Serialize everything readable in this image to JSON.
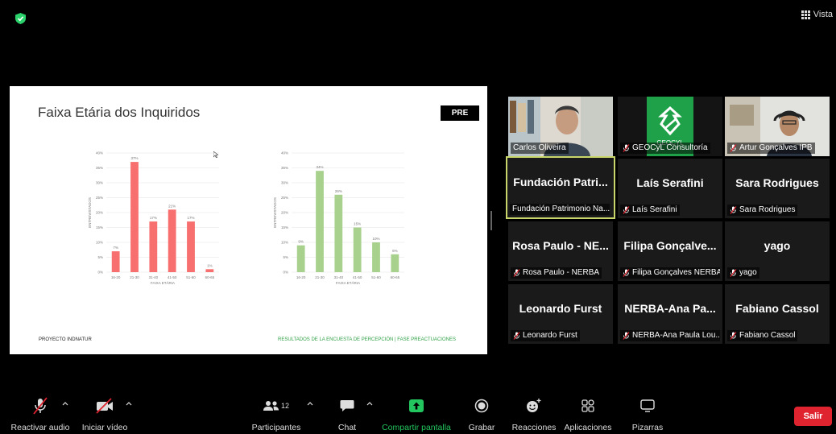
{
  "top_bar": {
    "view_label": "Vista",
    "security_color": "#2bd16a"
  },
  "slide": {
    "title": "Faixa Etária dos Inquiridos",
    "badge": "PRE",
    "footer_left": "PROYECTO INDNATUR",
    "footer_right": "RESULTADOS DE LA ENCUESTA DE PERCEPCIÓN | FASE PREACTUACIONES"
  },
  "chart_data": [
    {
      "type": "bar",
      "categories": [
        "16-20",
        "21-30",
        "31-40",
        "41-50",
        "51-60",
        "60-65"
      ],
      "values": [
        7,
        37,
        17,
        21,
        17,
        1
      ],
      "value_labels": [
        "7%",
        "37%",
        "17%",
        "21%",
        "17%",
        "1%"
      ],
      "y_ticks": [
        "0%",
        "5%",
        "10%",
        "15%",
        "20%",
        "25%",
        "30%",
        "35%",
        "40%"
      ],
      "ylim": [
        0,
        40
      ],
      "ylabel": "ENTREVISTADOS",
      "xlabel": "FAIXA ETÁRIA",
      "color": "#f7706f",
      "grid": true
    },
    {
      "type": "bar",
      "categories": [
        "16-20",
        "21-30",
        "31-40",
        "41-50",
        "51-60",
        "60-65"
      ],
      "values": [
        9,
        34,
        26,
        15,
        10,
        6
      ],
      "value_labels": [
        "9%",
        "34%",
        "26%",
        "15%",
        "10%",
        "6%"
      ],
      "y_ticks": [
        "0%",
        "5%",
        "10%",
        "15%",
        "20%",
        "25%",
        "30%",
        "35%",
        "40%"
      ],
      "ylim": [
        0,
        40
      ],
      "ylabel": "ENTREVISTADOS",
      "xlabel": "FAIXA ETÁRIA",
      "color": "#a9d18e",
      "grid": true
    }
  ],
  "participants": [
    {
      "display": "",
      "name": "Carlos Oliveira",
      "muted": false,
      "video": true
    },
    {
      "display": "",
      "name": "GEOCyL Consultoría",
      "muted": true,
      "video": true,
      "logo_text": "GEOCYL"
    },
    {
      "display": "",
      "name": "Artur Gonçalves IPB",
      "muted": true,
      "video": true
    },
    {
      "display": "Fundación Patri...",
      "name": "Fundación Patrimonio Na...",
      "muted": false,
      "video": false,
      "active": true
    },
    {
      "display": "Laís Serafini",
      "name": "Laís Serafini",
      "muted": true,
      "video": false
    },
    {
      "display": "Sara Rodrigues",
      "name": "Sara Rodrigues",
      "muted": true,
      "video": false
    },
    {
      "display": "Rosa Paulo - NE...",
      "name": "Rosa Paulo - NERBA",
      "muted": true,
      "video": false
    },
    {
      "display": "Filipa Gonçalve...",
      "name": "Filipa Gonçalves NERBA",
      "muted": true,
      "video": false
    },
    {
      "display": "yago",
      "name": "yago",
      "muted": true,
      "video": false
    },
    {
      "display": "Leonardo Furst",
      "name": "Leonardo Furst",
      "muted": true,
      "video": false
    },
    {
      "display": "NERBA-Ana Pa...",
      "name": "NERBA-Ana Paula Lou...",
      "muted": true,
      "video": false
    },
    {
      "display": "Fabiano Cassol",
      "name": "Fabiano Cassol",
      "muted": true,
      "video": false
    }
  ],
  "toolbar": {
    "audio_label": "Reactivar audio",
    "video_label": "Iniciar vídeo",
    "participants_label": "Participantes",
    "participants_count": "12",
    "chat_label": "Chat",
    "share_label": "Compartir pantalla",
    "record_label": "Grabar",
    "reactions_label": "Reacciones",
    "apps_label": "Aplicaciones",
    "whiteboard_label": "Pizarras",
    "leave_label": "Salir",
    "share_color": "#22c55e",
    "leave_color": "#e0242f"
  }
}
